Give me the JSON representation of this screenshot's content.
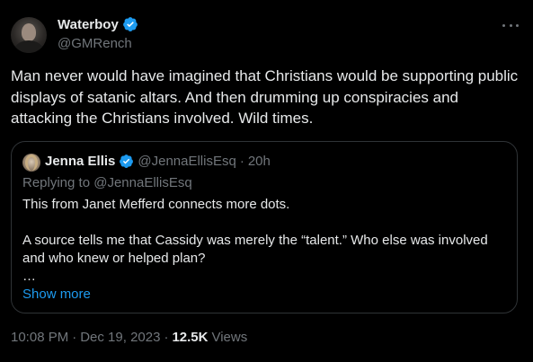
{
  "author": {
    "display_name": "Waterboy",
    "handle": "@GMRench",
    "avatar_icon": "profile-photo",
    "verified": true
  },
  "tweet": {
    "text": "Man never would have imagined that Christians would be supporting public displays of satanic altars. And then drumming up conspiracies and attacking the Christians involved. Wild times."
  },
  "quoted_tweet": {
    "display_name": "Jenna Ellis",
    "handle": "@JennaEllisEsq",
    "time": "20h",
    "separator": "·",
    "replying_prefix": "Replying to ",
    "replying_to": "@JennaEllisEsq",
    "paragraph_1": "This from Janet Mefferd connects more dots.",
    "paragraph_2": "A source tells me that Cassidy was merely the “talent.” Who else was involved and who knew or helped plan?",
    "ellipsis": "…",
    "show_more": "Show more"
  },
  "meta": {
    "time": "10:08 PM",
    "date": "Dec 19, 2023",
    "separator": "·",
    "views_count": "12.5K",
    "views_label": "Views"
  },
  "colors": {
    "background": "#000000",
    "text": "#e7e9ea",
    "muted": "#71767b",
    "accent": "#1d9bf0",
    "border": "#2f3336"
  }
}
